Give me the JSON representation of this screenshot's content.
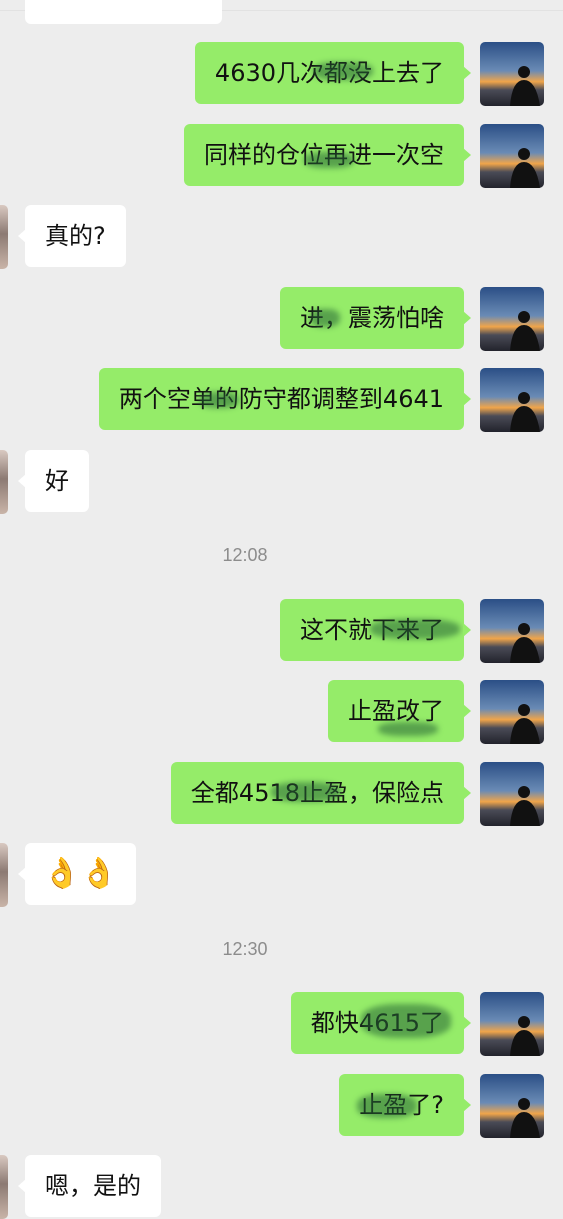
{
  "messages": [
    {
      "id": "m1",
      "side": "me",
      "text": "4630几次都没上去了"
    },
    {
      "id": "m2",
      "side": "me",
      "text": "同样的仓位再进一次空"
    },
    {
      "id": "m3",
      "side": "other",
      "text": "真的?"
    },
    {
      "id": "m4",
      "side": "me",
      "text": "进，震荡怕啥"
    },
    {
      "id": "m5",
      "side": "me",
      "text": "两个空单的防守都调整到4641"
    },
    {
      "id": "m6",
      "side": "other",
      "text": "好"
    },
    {
      "id": "m7",
      "side": "me",
      "text": "这不就下来了"
    },
    {
      "id": "m8",
      "side": "me",
      "text": "止盈改了"
    },
    {
      "id": "m9",
      "side": "me",
      "text": "全都4518止盈，保险点"
    },
    {
      "id": "m10",
      "side": "other",
      "text": "👌👌"
    },
    {
      "id": "m11",
      "side": "me",
      "text": "都快4615了"
    },
    {
      "id": "m12",
      "side": "me",
      "text": "止盈了?"
    },
    {
      "id": "m13",
      "side": "other",
      "text": "嗯，是的"
    }
  ],
  "timestamps": {
    "t1": "12:08",
    "t2": "12:30"
  },
  "avatar_icons": {
    "me": "sunset-silhouette-avatar-icon",
    "other": "partial-avatar-icon"
  },
  "colors": {
    "background": "#ededed",
    "my_bubble": "#95ec69",
    "other_bubble": "#ffffff",
    "timestamp_text": "#8c8c8c"
  }
}
